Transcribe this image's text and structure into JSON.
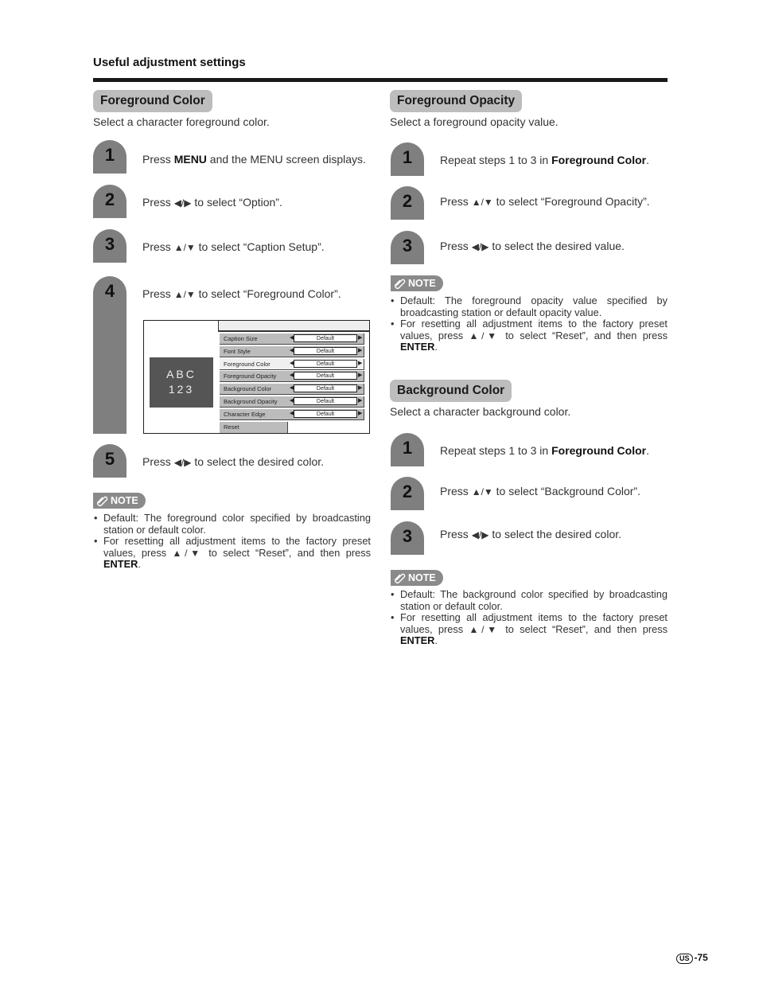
{
  "header": {
    "title": "Useful adjustment settings"
  },
  "left": {
    "title": "Foreground Color",
    "subtitle": "Select a character foreground color.",
    "steps": [
      {
        "num": "1",
        "pre": "Press ",
        "bold": "MENU",
        "post": " and the MENU screen displays."
      },
      {
        "num": "2",
        "pre": "Press ",
        "arrows": "◀/▶",
        "post": " to select “Option”."
      },
      {
        "num": "3",
        "pre": "Press ",
        "arrows": "▲/▼",
        "post": " to select “Caption Setup”."
      },
      {
        "num": "4",
        "pre": "Press ",
        "arrows": "▲/▼",
        "post": " to select “Foreground Color”."
      },
      {
        "num": "5",
        "pre": "Press ",
        "arrows": "◀/▶",
        "post": " to select the desired color."
      }
    ],
    "menu": {
      "preview_line1": "ABC",
      "preview_line2": "123",
      "rows": [
        {
          "label": "Caption Size",
          "value": "Default",
          "selected": false
        },
        {
          "label": "Font Style",
          "value": "Default",
          "selected": false
        },
        {
          "label": "Foreground Color",
          "value": "Default",
          "selected": true
        },
        {
          "label": "Foreground Opacity",
          "value": "Default",
          "selected": false
        },
        {
          "label": "Background Color",
          "value": "Default",
          "selected": false
        },
        {
          "label": "Background Opacity",
          "value": "Default",
          "selected": false
        },
        {
          "label": "Character Edge",
          "value": "Default",
          "selected": false
        }
      ],
      "reset_label": "Reset",
      "left_arrow": "◀",
      "right_arrow": "▶"
    },
    "note": {
      "label": "NOTE",
      "items": [
        {
          "text": "Default: The foreground color specified by broadcasting station or default color."
        },
        {
          "pre": "For resetting all adjustment items to the factory preset values, press ",
          "arrows": "▲/▼",
          "mid": " to select “Reset”, and then press ",
          "bold": "ENTER",
          "post": "."
        }
      ]
    }
  },
  "right_top": {
    "title": "Foreground Opacity",
    "subtitle": "Select a foreground opacity value.",
    "steps": [
      {
        "num": "1",
        "pre": "Repeat steps 1 to 3 in ",
        "bold": "Foreground Color",
        "post": "."
      },
      {
        "num": "2",
        "pre": "Press ",
        "arrows": "▲/▼",
        "post": " to select “Foreground Opacity”."
      },
      {
        "num": "3",
        "pre": "Press ",
        "arrows": "◀/▶",
        "post": " to select the desired value."
      }
    ],
    "note": {
      "label": "NOTE",
      "items": [
        {
          "text": "Default: The foreground opacity value specified by broadcasting station or default opacity value."
        },
        {
          "pre": "For resetting all adjustment items to the factory preset values, press ",
          "arrows": "▲/▼",
          "mid": " to select “Reset”, and then press ",
          "bold": "ENTER",
          "post": "."
        }
      ]
    }
  },
  "right_bottom": {
    "title": "Background Color",
    "subtitle": "Select a character background color.",
    "steps": [
      {
        "num": "1",
        "pre": "Repeat steps 1 to 3 in ",
        "bold": "Foreground Color",
        "post": "."
      },
      {
        "num": "2",
        "pre": "Press ",
        "arrows": "▲/▼",
        "post": " to select “Background Color”."
      },
      {
        "num": "3",
        "pre": "Press ",
        "arrows": "◀/▶",
        "post": " to select the desired color."
      }
    ],
    "note": {
      "label": "NOTE",
      "items": [
        {
          "text": "Default: The background color specified by broadcasting station or default color."
        },
        {
          "pre": "For resetting all adjustment items to the factory preset values, press ",
          "arrows": "▲/▼",
          "mid": " to select “Reset”, and then press ",
          "bold": "ENTER",
          "post": "."
        }
      ]
    }
  },
  "footer": {
    "region": "US",
    "page": "-75"
  }
}
